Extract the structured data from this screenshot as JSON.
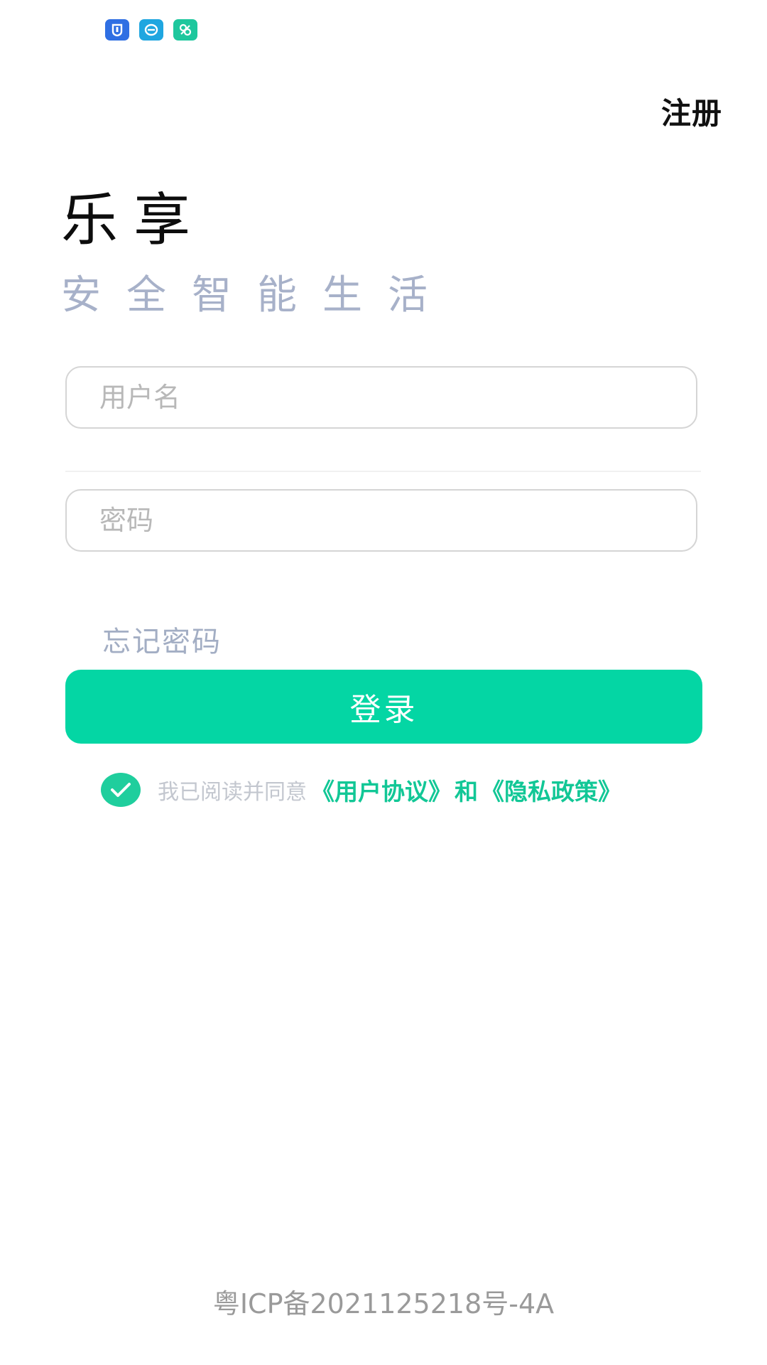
{
  "status_bar": {
    "icons": [
      "shield-app-icon",
      "chat-app-icon",
      "qr-app-icon"
    ]
  },
  "header": {
    "register_label": "注册"
  },
  "brand": {
    "title": "乐享",
    "slogan": "安全智能生活"
  },
  "form": {
    "username": {
      "placeholder": "用户名",
      "value": ""
    },
    "password": {
      "placeholder": "密码",
      "value": ""
    },
    "forgot_password_label": "忘记密码",
    "login_label": "登录"
  },
  "agreement": {
    "checked": true,
    "prefix": "我已阅读并同意",
    "user_agreement": "《用户协议》",
    "and": "和",
    "privacy_policy": "《隐私政策》"
  },
  "footer": {
    "icp": "粤ICP备2021125218号-4A"
  },
  "colors": {
    "accent": "#04d6a4",
    "link": "#12c796",
    "slogan": "#a7b1c9",
    "forgot": "#a3aec4"
  }
}
